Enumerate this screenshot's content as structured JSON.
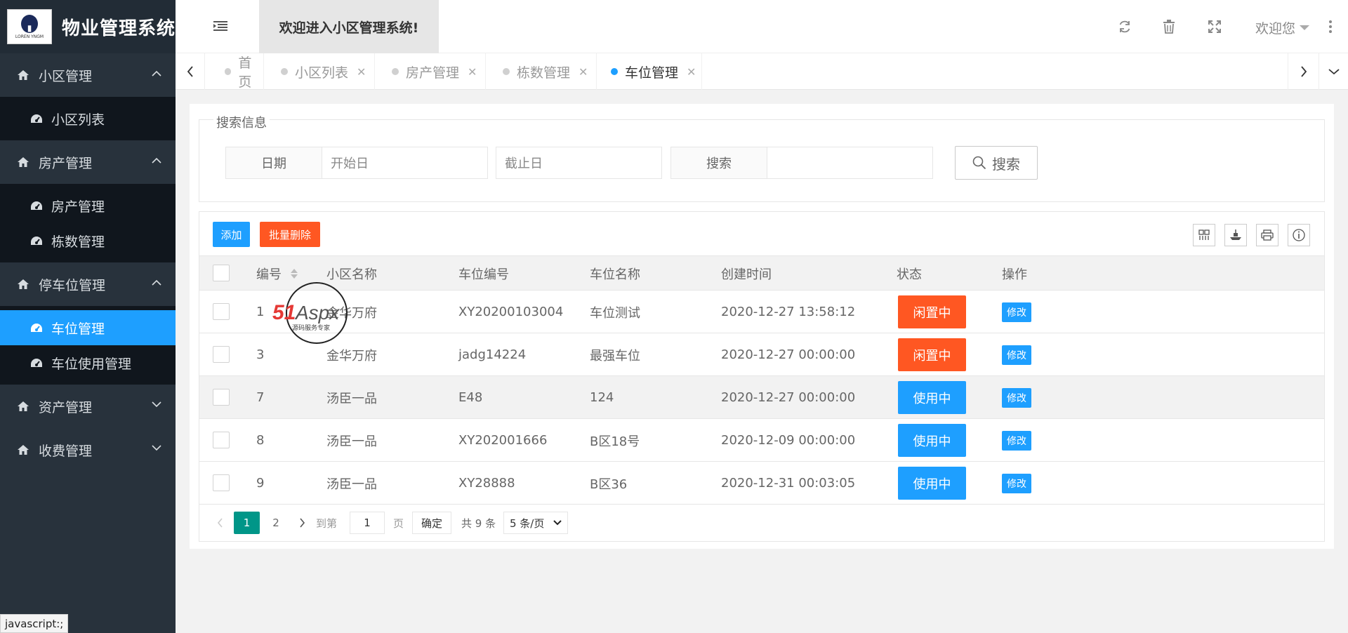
{
  "app": {
    "title": "物业管理系统",
    "logo_caption": "LOREN YNGM"
  },
  "sidebar": {
    "groups": [
      {
        "label": "小区管理",
        "expanded": true,
        "items": [
          {
            "label": "小区列表",
            "active": false
          }
        ]
      },
      {
        "label": "房产管理",
        "expanded": true,
        "items": [
          {
            "label": "房产管理",
            "active": false
          },
          {
            "label": "栋数管理",
            "active": false
          }
        ]
      },
      {
        "label": "停车位管理",
        "expanded": true,
        "items": [
          {
            "label": "车位管理",
            "active": true
          },
          {
            "label": "车位使用管理",
            "active": false
          }
        ]
      },
      {
        "label": "资产管理",
        "expanded": false,
        "items": []
      },
      {
        "label": "收费管理",
        "expanded": false,
        "items": []
      }
    ]
  },
  "header": {
    "welcome": "欢迎进入小区管理系统!",
    "user": "欢迎您",
    "icons": [
      "menu-toggle-icon",
      "refresh-icon",
      "trash-icon",
      "fullscreen-icon",
      "more-vertical-icon"
    ]
  },
  "tabs": [
    {
      "label": "首页",
      "closable": false,
      "active": false
    },
    {
      "label": "小区列表",
      "closable": true,
      "active": false
    },
    {
      "label": "房产管理",
      "closable": true,
      "active": false
    },
    {
      "label": "栋数管理",
      "closable": true,
      "active": false
    },
    {
      "label": "车位管理",
      "closable": true,
      "active": true
    }
  ],
  "search": {
    "legend": "搜索信息",
    "date_label": "日期",
    "start_placeholder": "开始日",
    "end_placeholder": "截止日",
    "keyword_label": "搜索",
    "keyword_value": "",
    "button": "搜索"
  },
  "toolbar": {
    "add": "添加",
    "batch_delete": "批量删除",
    "icons": [
      "columns-icon",
      "export-icon",
      "print-icon",
      "info-icon"
    ]
  },
  "table": {
    "columns": [
      "编号",
      "小区名称",
      "车位编号",
      "车位名称",
      "创建时间",
      "状态",
      "操作"
    ],
    "rows": [
      {
        "id": "1",
        "community": "金华万府",
        "code": "XY20200103004",
        "name": "车位测试",
        "created": "2020-12-27 13:58:12",
        "status": "闲置中",
        "status_type": "idle",
        "action": "修改"
      },
      {
        "id": "3",
        "community": "金华万府",
        "code": "jadg14224",
        "name": "最强车位",
        "created": "2020-12-27 00:00:00",
        "status": "闲置中",
        "status_type": "idle",
        "action": "修改"
      },
      {
        "id": "7",
        "community": "汤臣一品",
        "code": "E48",
        "name": "124",
        "created": "2020-12-27 00:00:00",
        "status": "使用中",
        "status_type": "use",
        "action": "修改"
      },
      {
        "id": "8",
        "community": "汤臣一品",
        "code": "XY202001666",
        "name": "B区18号",
        "created": "2020-12-09 00:00:00",
        "status": "使用中",
        "status_type": "use",
        "action": "修改"
      },
      {
        "id": "9",
        "community": "汤臣一品",
        "code": "XY28888",
        "name": "B区36",
        "created": "2020-12-31 00:03:05",
        "status": "使用中",
        "status_type": "use",
        "action": "修改"
      }
    ],
    "highlighted_row": 2
  },
  "pagination": {
    "pages": [
      "1",
      "2"
    ],
    "current": "1",
    "goto_label": "到第",
    "goto_value": "1",
    "page_unit": "页",
    "confirm": "确定",
    "total": "共 9 条",
    "page_size": "5 条/页"
  },
  "watermark": {
    "brand": "51Aspx",
    "tagline": "源码服务专家"
  },
  "statusbar": {
    "text": "javascript:;"
  },
  "colors": {
    "sidebar": "#28323c",
    "active": "#1e9fff",
    "danger": "#ff5722",
    "pager_current": "#009688"
  }
}
